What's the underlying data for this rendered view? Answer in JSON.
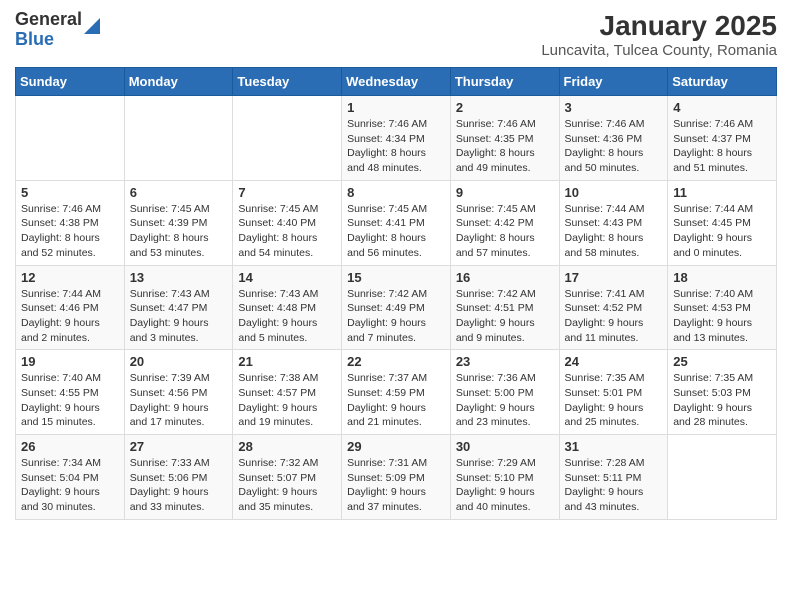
{
  "logo": {
    "general": "General",
    "blue": "Blue"
  },
  "title": "January 2025",
  "subtitle": "Luncavita, Tulcea County, Romania",
  "days_of_week": [
    "Sunday",
    "Monday",
    "Tuesday",
    "Wednesday",
    "Thursday",
    "Friday",
    "Saturday"
  ],
  "weeks": [
    [
      {
        "day": "",
        "info": ""
      },
      {
        "day": "",
        "info": ""
      },
      {
        "day": "",
        "info": ""
      },
      {
        "day": "1",
        "info": "Sunrise: 7:46 AM\nSunset: 4:34 PM\nDaylight: 8 hours\nand 48 minutes."
      },
      {
        "day": "2",
        "info": "Sunrise: 7:46 AM\nSunset: 4:35 PM\nDaylight: 8 hours\nand 49 minutes."
      },
      {
        "day": "3",
        "info": "Sunrise: 7:46 AM\nSunset: 4:36 PM\nDaylight: 8 hours\nand 50 minutes."
      },
      {
        "day": "4",
        "info": "Sunrise: 7:46 AM\nSunset: 4:37 PM\nDaylight: 8 hours\nand 51 minutes."
      }
    ],
    [
      {
        "day": "5",
        "info": "Sunrise: 7:46 AM\nSunset: 4:38 PM\nDaylight: 8 hours\nand 52 minutes."
      },
      {
        "day": "6",
        "info": "Sunrise: 7:45 AM\nSunset: 4:39 PM\nDaylight: 8 hours\nand 53 minutes."
      },
      {
        "day": "7",
        "info": "Sunrise: 7:45 AM\nSunset: 4:40 PM\nDaylight: 8 hours\nand 54 minutes."
      },
      {
        "day": "8",
        "info": "Sunrise: 7:45 AM\nSunset: 4:41 PM\nDaylight: 8 hours\nand 56 minutes."
      },
      {
        "day": "9",
        "info": "Sunrise: 7:45 AM\nSunset: 4:42 PM\nDaylight: 8 hours\nand 57 minutes."
      },
      {
        "day": "10",
        "info": "Sunrise: 7:44 AM\nSunset: 4:43 PM\nDaylight: 8 hours\nand 58 minutes."
      },
      {
        "day": "11",
        "info": "Sunrise: 7:44 AM\nSunset: 4:45 PM\nDaylight: 9 hours\nand 0 minutes."
      }
    ],
    [
      {
        "day": "12",
        "info": "Sunrise: 7:44 AM\nSunset: 4:46 PM\nDaylight: 9 hours\nand 2 minutes."
      },
      {
        "day": "13",
        "info": "Sunrise: 7:43 AM\nSunset: 4:47 PM\nDaylight: 9 hours\nand 3 minutes."
      },
      {
        "day": "14",
        "info": "Sunrise: 7:43 AM\nSunset: 4:48 PM\nDaylight: 9 hours\nand 5 minutes."
      },
      {
        "day": "15",
        "info": "Sunrise: 7:42 AM\nSunset: 4:49 PM\nDaylight: 9 hours\nand 7 minutes."
      },
      {
        "day": "16",
        "info": "Sunrise: 7:42 AM\nSunset: 4:51 PM\nDaylight: 9 hours\nand 9 minutes."
      },
      {
        "day": "17",
        "info": "Sunrise: 7:41 AM\nSunset: 4:52 PM\nDaylight: 9 hours\nand 11 minutes."
      },
      {
        "day": "18",
        "info": "Sunrise: 7:40 AM\nSunset: 4:53 PM\nDaylight: 9 hours\nand 13 minutes."
      }
    ],
    [
      {
        "day": "19",
        "info": "Sunrise: 7:40 AM\nSunset: 4:55 PM\nDaylight: 9 hours\nand 15 minutes."
      },
      {
        "day": "20",
        "info": "Sunrise: 7:39 AM\nSunset: 4:56 PM\nDaylight: 9 hours\nand 17 minutes."
      },
      {
        "day": "21",
        "info": "Sunrise: 7:38 AM\nSunset: 4:57 PM\nDaylight: 9 hours\nand 19 minutes."
      },
      {
        "day": "22",
        "info": "Sunrise: 7:37 AM\nSunset: 4:59 PM\nDaylight: 9 hours\nand 21 minutes."
      },
      {
        "day": "23",
        "info": "Sunrise: 7:36 AM\nSunset: 5:00 PM\nDaylight: 9 hours\nand 23 minutes."
      },
      {
        "day": "24",
        "info": "Sunrise: 7:35 AM\nSunset: 5:01 PM\nDaylight: 9 hours\nand 25 minutes."
      },
      {
        "day": "25",
        "info": "Sunrise: 7:35 AM\nSunset: 5:03 PM\nDaylight: 9 hours\nand 28 minutes."
      }
    ],
    [
      {
        "day": "26",
        "info": "Sunrise: 7:34 AM\nSunset: 5:04 PM\nDaylight: 9 hours\nand 30 minutes."
      },
      {
        "day": "27",
        "info": "Sunrise: 7:33 AM\nSunset: 5:06 PM\nDaylight: 9 hours\nand 33 minutes."
      },
      {
        "day": "28",
        "info": "Sunrise: 7:32 AM\nSunset: 5:07 PM\nDaylight: 9 hours\nand 35 minutes."
      },
      {
        "day": "29",
        "info": "Sunrise: 7:31 AM\nSunset: 5:09 PM\nDaylight: 9 hours\nand 37 minutes."
      },
      {
        "day": "30",
        "info": "Sunrise: 7:29 AM\nSunset: 5:10 PM\nDaylight: 9 hours\nand 40 minutes."
      },
      {
        "day": "31",
        "info": "Sunrise: 7:28 AM\nSunset: 5:11 PM\nDaylight: 9 hours\nand 43 minutes."
      },
      {
        "day": "",
        "info": ""
      }
    ]
  ]
}
